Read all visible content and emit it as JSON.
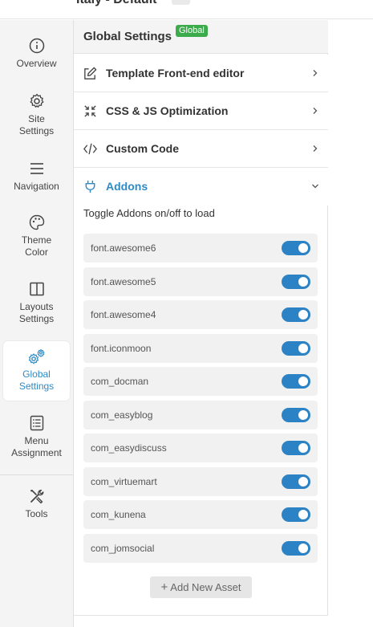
{
  "topbar": {
    "title": "Italy - Default"
  },
  "sidebar": {
    "items": [
      {
        "label": "Overview",
        "icon": "info-icon"
      },
      {
        "label": "Site Settings",
        "icon": "gear-icon"
      },
      {
        "label": "Navigation",
        "icon": "menu-icon"
      },
      {
        "label": "Theme Color",
        "icon": "palette-icon"
      },
      {
        "label": "Layouts Settings",
        "icon": "layout-icon"
      },
      {
        "label": "Global Settings",
        "icon": "gears-icon"
      },
      {
        "label": "Menu Assignment",
        "icon": "list-icon"
      },
      {
        "label": "Tools",
        "icon": "tools-icon"
      }
    ],
    "active": "Global Settings"
  },
  "panel": {
    "title": "Global Settings",
    "badge": "Global",
    "sections": [
      {
        "label": "Template Front-end editor",
        "icon": "edit-icon"
      },
      {
        "label": "CSS & JS Optimization",
        "icon": "compress-icon"
      },
      {
        "label": "Custom Code",
        "icon": "code-icon"
      },
      {
        "label": "Addons",
        "icon": "plug-icon",
        "expanded": true
      }
    ],
    "addons_hint": "Toggle Addons on/off to load",
    "addons": [
      {
        "name": "font.awesome6",
        "enabled": true
      },
      {
        "name": "font.awesome5",
        "enabled": true
      },
      {
        "name": "font.awesome4",
        "enabled": true
      },
      {
        "name": "font.iconmoon",
        "enabled": true
      },
      {
        "name": "com_docman",
        "enabled": true
      },
      {
        "name": "com_easyblog",
        "enabled": true
      },
      {
        "name": "com_easydiscuss",
        "enabled": true
      },
      {
        "name": "com_virtuemart",
        "enabled": true
      },
      {
        "name": "com_kunena",
        "enabled": true
      },
      {
        "name": "com_jomsocial",
        "enabled": true
      }
    ],
    "add_button": "Add New Asset"
  },
  "colors": {
    "accent": "#2e8bc6",
    "badge": "#3bab4c",
    "toggle_on": "#2b83c6"
  }
}
